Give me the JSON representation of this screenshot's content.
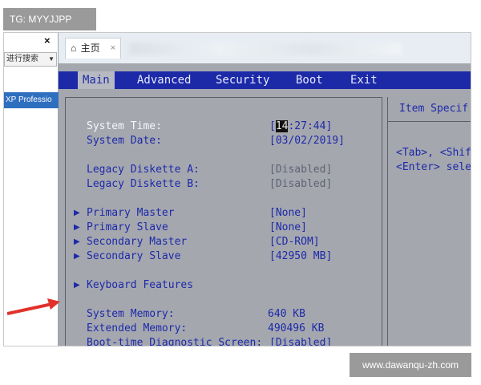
{
  "watermark_top": "TG: MYYJJPP",
  "watermark_bottom": "www.dawanqu-zh.com",
  "host": {
    "close_glyph": "×",
    "search_label": "进行搜索",
    "selected_item": "XP Professio",
    "tab_label": "主页",
    "tab_close": "×",
    "home_icon": "⌂"
  },
  "bios": {
    "menus": [
      "Main",
      "Advanced",
      "Security",
      "Boot",
      "Exit"
    ],
    "active_menu": "Main",
    "help_title": "Item Specif",
    "help_lines": [
      "<Tab>, <Shift",
      "<Enter> selec"
    ],
    "system_time_label": "System Time:",
    "system_time_bracket_open": "[",
    "system_time_cursor": "14",
    "system_time_rest": ":27:44]",
    "system_date_label": "System Date:",
    "system_date": "[03/02/2019]",
    "legacy_a_label": "Legacy Diskette A:",
    "legacy_a": "[Disabled]",
    "legacy_b_label": "Legacy Diskette B:",
    "legacy_b": "[Disabled]",
    "primary_master_label": "Primary Master",
    "primary_master": "[None]",
    "primary_slave_label": "Primary Slave",
    "primary_slave": "[None]",
    "secondary_master_label": "Secondary Master",
    "secondary_master": "[CD-ROM]",
    "secondary_slave_label": "Secondary Slave",
    "secondary_slave": "[42950 MB]",
    "keyboard_label": "Keyboard Features",
    "system_memory_label": "System Memory:",
    "system_memory": "640 KB",
    "extended_memory_label": "Extended Memory:",
    "extended_memory": "490496 KB",
    "boot_diag_label": "Boot-time Diagnostic Screen:",
    "boot_diag": "[Disabled]",
    "submenu_glyph": "▶"
  },
  "colors": {
    "bios_blue": "#1c2aa8",
    "bios_gray": "#a5a7af",
    "arrow_red": "#e0322b"
  }
}
